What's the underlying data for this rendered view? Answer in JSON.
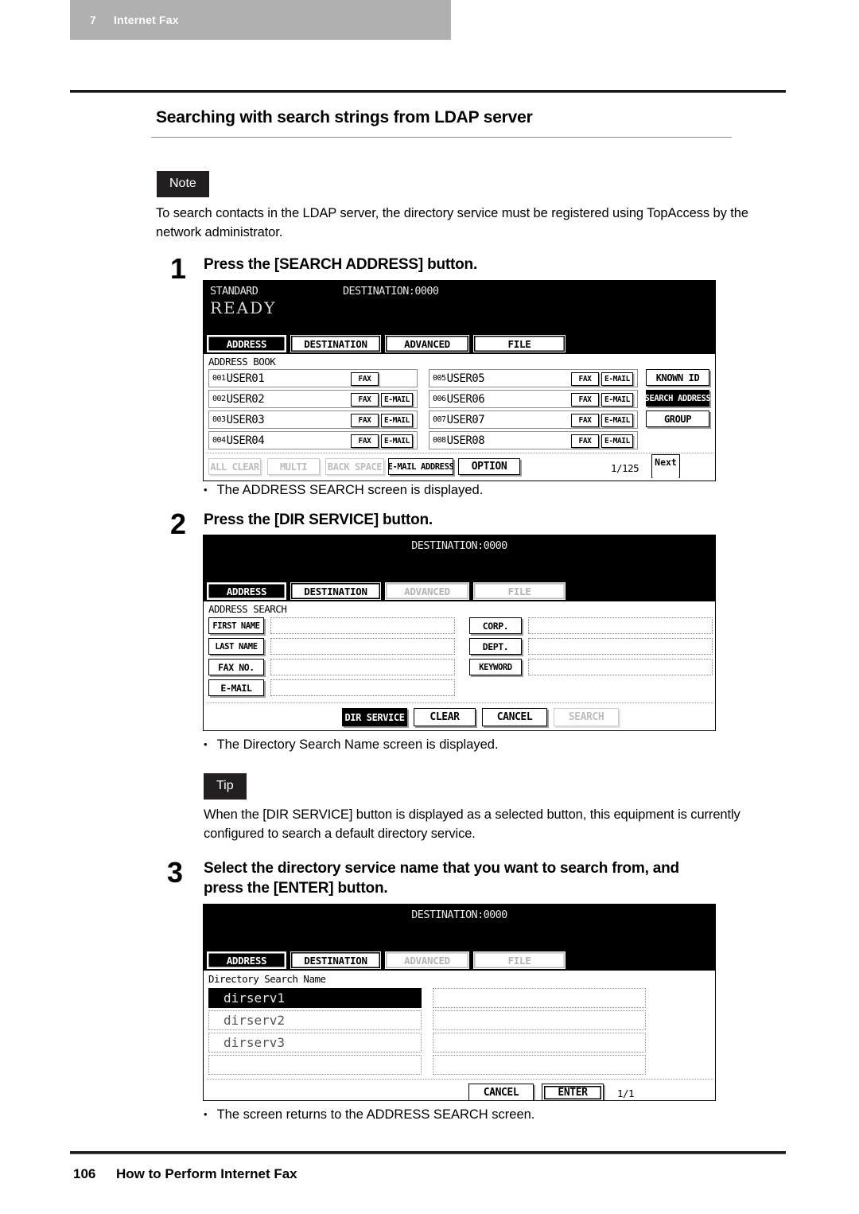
{
  "header": {
    "chapter_number": "7",
    "chapter_name": "Internet Fax"
  },
  "section": {
    "title": "Searching with search strings from LDAP server"
  },
  "note": {
    "badge": "Note",
    "text": "To search contacts in the LDAP server, the directory service must be registered using TopAccess by the network administrator."
  },
  "tip": {
    "badge": "Tip",
    "text": "When the [DIR SERVICE] button is displayed as a selected button, this equipment is currently configured to search a default directory service."
  },
  "steps": [
    {
      "number": "1",
      "heading": "Press the [SEARCH ADDRESS] button.",
      "result": "The ADDRESS SEARCH screen is displayed."
    },
    {
      "number": "2",
      "heading": "Press the [DIR SERVICE] button.",
      "result": "The Directory Search Name screen is displayed."
    },
    {
      "number": "3",
      "heading_line1": "Select the directory service name that you want to search from, and",
      "heading_line2": "press the [ENTER] button.",
      "result": "The screen returns to the ADDRESS SEARCH screen."
    }
  ],
  "screen1": {
    "status_left": "STANDARD",
    "status_destination": "DESTINATION:0000",
    "ready": "READY",
    "tabs": [
      {
        "label": "ADDRESS",
        "state": "selected"
      },
      {
        "label": "DESTINATION",
        "state": "normal"
      },
      {
        "label": "ADVANCED",
        "state": "normal"
      },
      {
        "label": "FILE",
        "state": "normal"
      }
    ],
    "caption": "ADDRESS BOOK",
    "entries_left": [
      {
        "index": "001",
        "name": "USER01",
        "fax": "FAX",
        "email": ""
      },
      {
        "index": "002",
        "name": "USER02",
        "fax": "FAX",
        "email": "E-MAIL"
      },
      {
        "index": "003",
        "name": "USER03",
        "fax": "FAX",
        "email": "E-MAIL"
      },
      {
        "index": "004",
        "name": "USER04",
        "fax": "FAX",
        "email": "E-MAIL"
      }
    ],
    "entries_right": [
      {
        "index": "005",
        "name": "USER05",
        "fax": "FAX",
        "email": "E-MAIL"
      },
      {
        "index": "006",
        "name": "USER06",
        "fax": "FAX",
        "email": "E-MAIL"
      },
      {
        "index": "007",
        "name": "USER07",
        "fax": "FAX",
        "email": "E-MAIL"
      },
      {
        "index": "008",
        "name": "USER08",
        "fax": "FAX",
        "email": "E-MAIL"
      }
    ],
    "side_buttons": [
      {
        "label": "KNOWN ID",
        "state": "normal"
      },
      {
        "label": "SEARCH ADDRESS",
        "state": "selected"
      },
      {
        "label": "GROUP",
        "state": "normal"
      }
    ],
    "bottom_buttons": [
      {
        "label": "ALL CLEAR",
        "state": "disabled"
      },
      {
        "label": "MULTI",
        "state": "disabled"
      },
      {
        "label": "BACK SPACE",
        "state": "disabled"
      },
      {
        "label": "E-MAIL ADDRESS",
        "state": "normal"
      },
      {
        "label": "OPTION",
        "state": "normal"
      }
    ],
    "page_indicator": "1/125",
    "next_label": "Next"
  },
  "screen2": {
    "status_destination": "DESTINATION:0000",
    "tabs": [
      {
        "label": "ADDRESS",
        "state": "selected"
      },
      {
        "label": "DESTINATION",
        "state": "normal"
      },
      {
        "label": "ADVANCED",
        "state": "disabled"
      },
      {
        "label": "FILE",
        "state": "disabled"
      }
    ],
    "caption": "ADDRESS SEARCH",
    "fields_left": [
      {
        "label": "FIRST NAME",
        "value": ""
      },
      {
        "label": "LAST NAME",
        "value": ""
      },
      {
        "label": "FAX NO.",
        "value": ""
      },
      {
        "label": "E-MAIL",
        "value": ""
      }
    ],
    "fields_right": [
      {
        "label": "CORP.",
        "value": ""
      },
      {
        "label": "DEPT.",
        "value": ""
      },
      {
        "label": "KEYWORD",
        "value": ""
      }
    ],
    "bottom_buttons": [
      {
        "label": "DIR SERVICE",
        "state": "selected"
      },
      {
        "label": "CLEAR",
        "state": "normal"
      },
      {
        "label": "CANCEL",
        "state": "normal"
      },
      {
        "label": "SEARCH",
        "state": "disabled"
      }
    ]
  },
  "screen3": {
    "status_destination": "DESTINATION:0000",
    "tabs": [
      {
        "label": "ADDRESS",
        "state": "selected"
      },
      {
        "label": "DESTINATION",
        "state": "normal"
      },
      {
        "label": "ADVANCED",
        "state": "disabled"
      },
      {
        "label": "FILE",
        "state": "disabled"
      }
    ],
    "caption": "Directory Search Name",
    "list_left": [
      {
        "label": "dirserv1",
        "state": "selected"
      },
      {
        "label": "dirserv2",
        "state": "normal"
      },
      {
        "label": "dirserv3",
        "state": "normal"
      },
      {
        "label": "",
        "state": "normal"
      }
    ],
    "list_right": [
      {
        "label": "",
        "state": "normal"
      },
      {
        "label": "",
        "state": "normal"
      },
      {
        "label": "",
        "state": "normal"
      },
      {
        "label": "",
        "state": "normal"
      }
    ],
    "bottom_buttons": [
      {
        "label": "CANCEL",
        "state": "normal"
      },
      {
        "label": "ENTER",
        "state": "normal"
      }
    ],
    "page_indicator": "1/1"
  },
  "footer": {
    "page_number": "106",
    "title": "How to Perform Internet Fax"
  },
  "colors": {
    "chapter_bar": "#b0b0b0",
    "badge_bg": "#231f20",
    "lcd_bg": "#000000",
    "rule": "#1a1a1a"
  }
}
